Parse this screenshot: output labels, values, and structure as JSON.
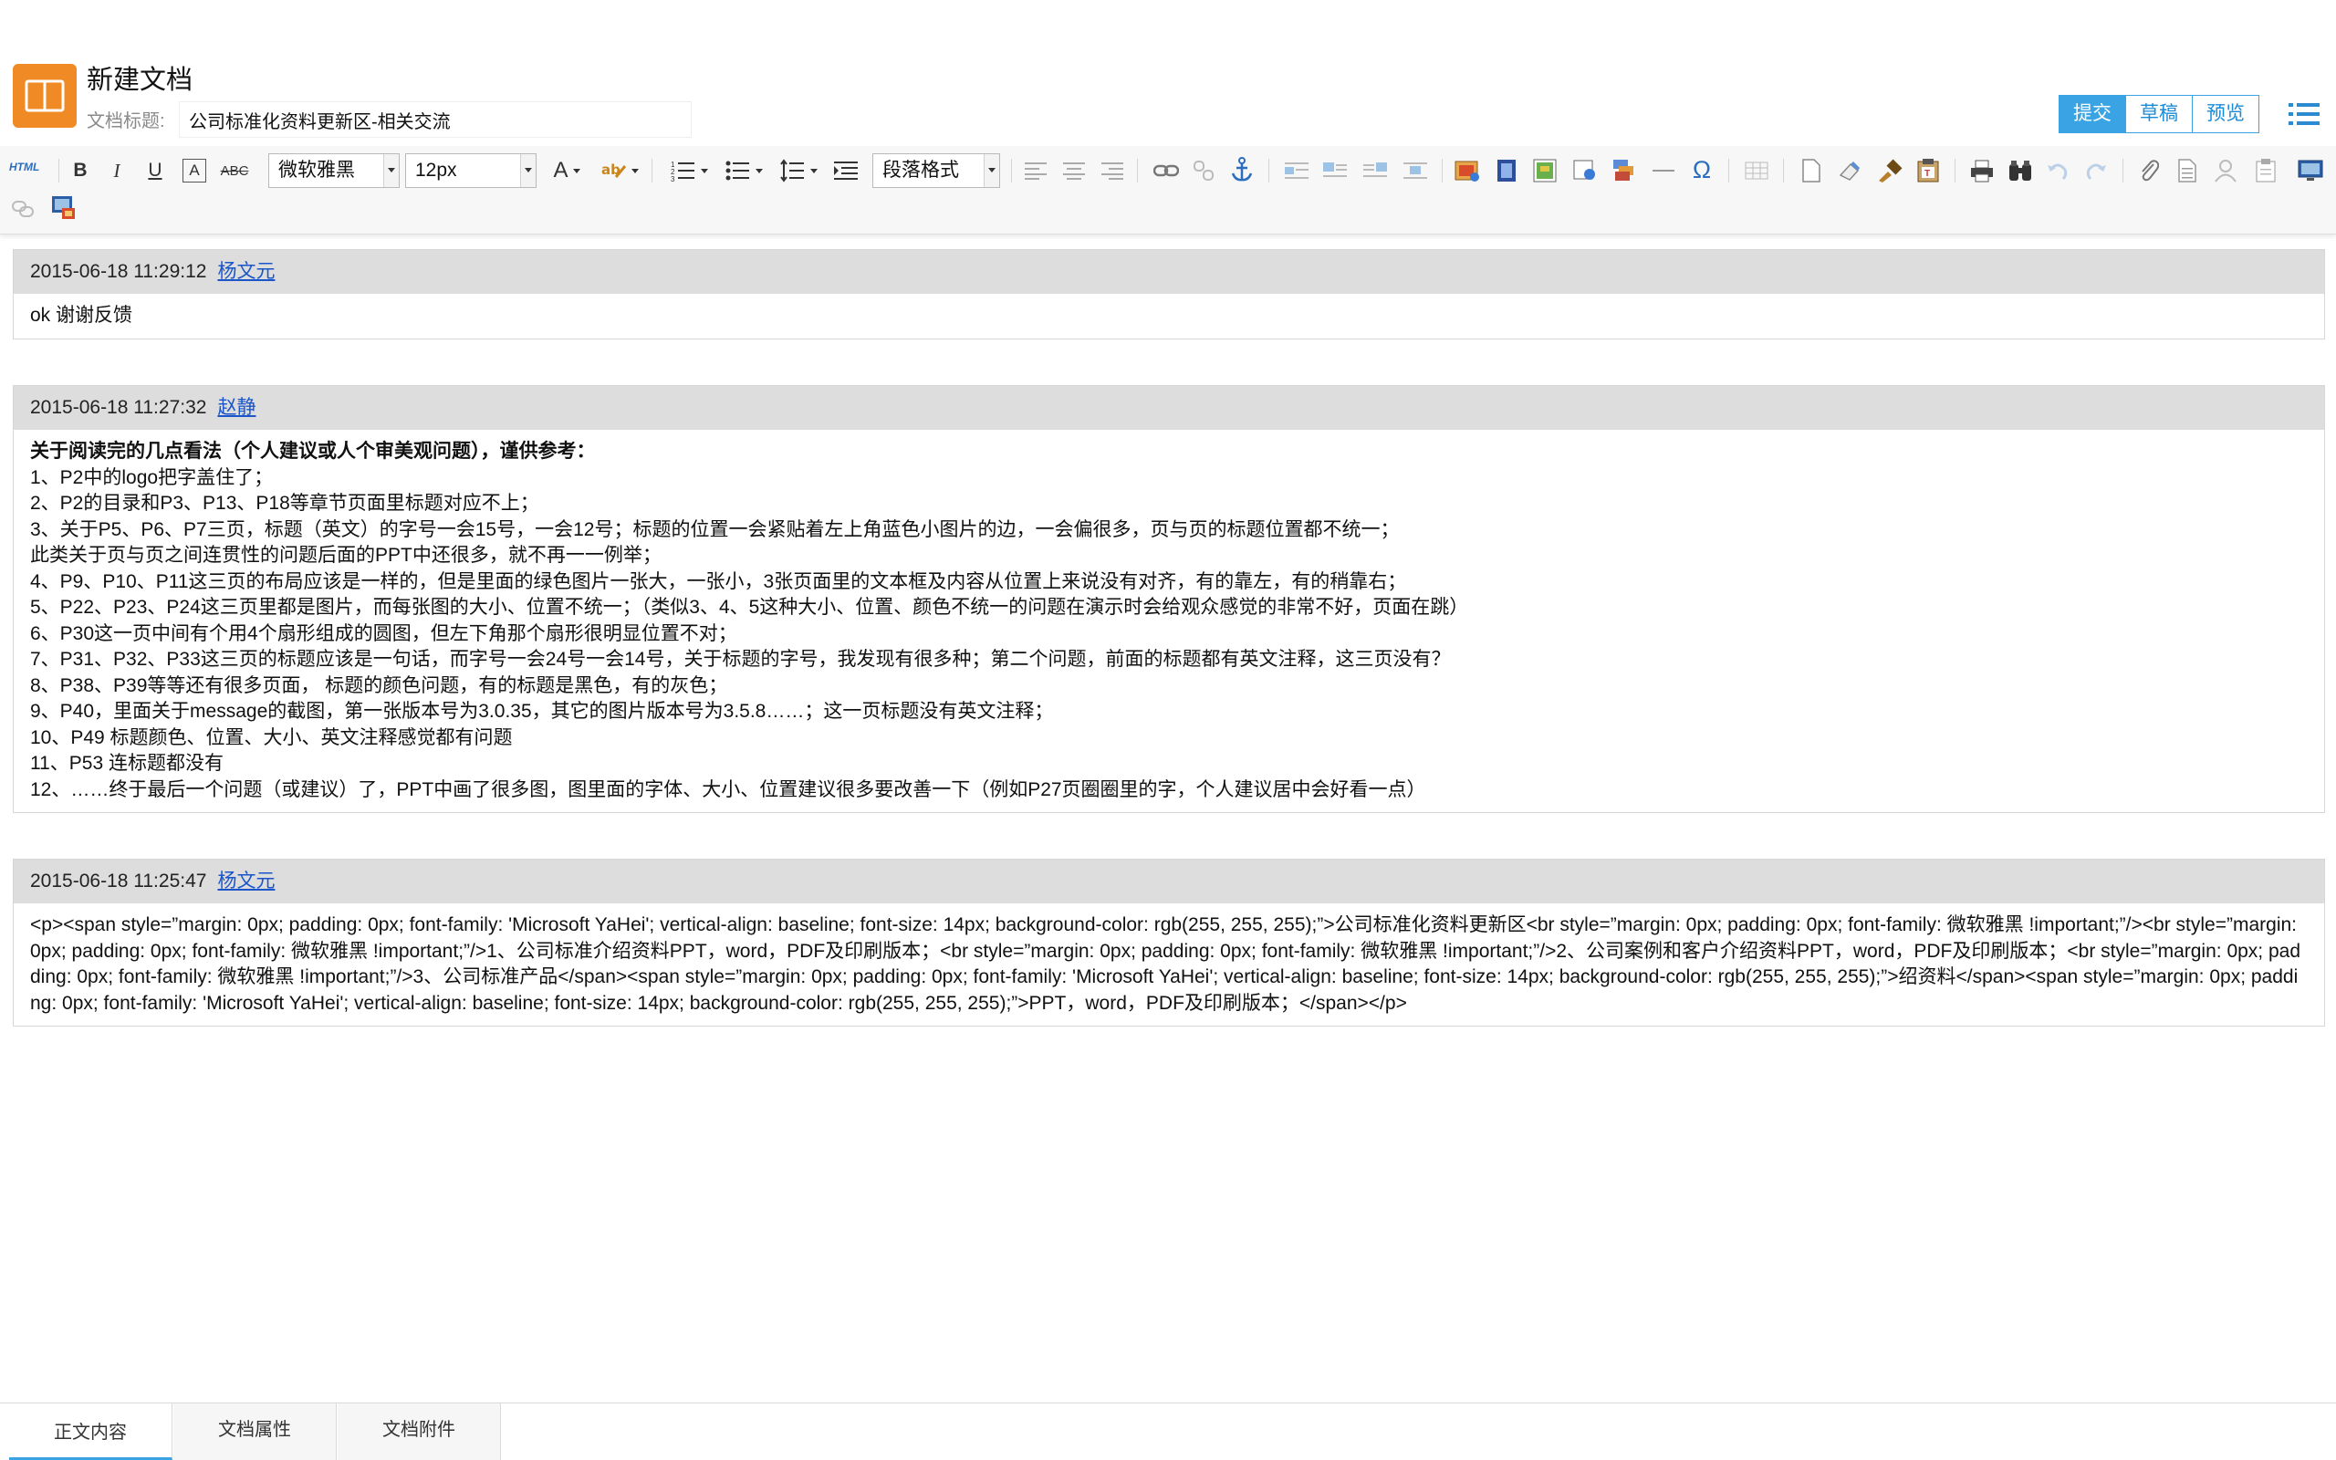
{
  "header": {
    "title": "新建文档",
    "title_label": "文档标题:",
    "title_value": "公司标准化资料更新区-相关交流",
    "actions": {
      "submit": "提交",
      "draft": "草稿",
      "preview": "预览"
    }
  },
  "toolbar": {
    "html_label": "HTML",
    "font_family": "微软雅黑",
    "font_size": "12px",
    "paragraph_format": "段落格式",
    "icons": [
      "html-source",
      "bold",
      "italic",
      "underline",
      "font-border",
      "strikethrough",
      "font-family",
      "font-size",
      "font-color",
      "back-color",
      "ordered-list",
      "unordered-list",
      "line-height",
      "indent",
      "paragraph",
      "justify-left",
      "justify-center",
      "justify-right",
      "link",
      "unlink",
      "anchor",
      "image-none",
      "image-left",
      "image-right",
      "image-center",
      "insert-image",
      "insert-video",
      "insert-map",
      "insert-frame",
      "insert-code",
      "horizontal-rule",
      "special-char",
      "insert-table",
      "new-doc",
      "eraser",
      "format-brush",
      "paste-plain",
      "print",
      "search-replace",
      "undo",
      "redo",
      "attachment",
      "template",
      "help",
      "clipboard",
      "fullscreen",
      "remove-format",
      "snapshot"
    ]
  },
  "comments": [
    {
      "time": "2015-06-18 11:29:12",
      "author": "杨文元",
      "lines": [
        "ok  谢谢反馈"
      ]
    },
    {
      "time": "2015-06-18 11:27:32",
      "author": "赵静",
      "heading": "关于阅读完的几点看法（个人建议或人个审美观问题），谨供参考：",
      "lines": [
        "1、P2中的logo把字盖住了；",
        "2、P2的目录和P3、P13、P18等章节页面里标题对应不上；",
        "3、关于P5、P6、P7三页，标题（英文）的字号一会15号，一会12号；标题的位置一会紧贴着左上角蓝色小图片的边，一会偏很多，页与页的标题位置都不统一；",
        "此类关于页与页之间连贯性的问题后面的PPT中还很多，就不再一一例举；",
        "4、P9、P10、P11这三页的布局应该是一样的，但是里面的绿色图片一张大，一张小，3张页面里的文本框及内容从位置上来说没有对齐，有的靠左，有的稍靠右；",
        "5、P22、P23、P24这三页里都是图片，而每张图的大小、位置不统一；（类似3、4、5这种大小、位置、颜色不统一的问题在演示时会给观众感觉的非常不好，页面在跳）",
        "6、P30这一页中间有个用4个扇形组成的圆图，但左下角那个扇形很明显位置不对；",
        "7、P31、P32、P33这三页的标题应该是一句话，而字号一会24号一会14号，关于标题的字号，我发现有很多种；第二个问题，前面的标题都有英文注释，这三页没有？",
        "8、P38、P39等等还有很多页面， 标题的颜色问题，有的标题是黑色，有的灰色；",
        "9、P40，里面关于message的截图，第一张版本号为3.0.35，其它的图片版本号为3.5.8……；这一页标题没有英文注释；",
        "10、P49 标题颜色、位置、大小、英文注释感觉都有问题",
        "11、P53 连标题都没有",
        "12、……终于最后一个问题（或建议）了，PPT中画了很多图，图里面的字体、大小、位置建议很多要改善一下（例如P27页圈圈里的字，个人建议居中会好看一点）"
      ]
    },
    {
      "time": "2015-06-18 11:25:47",
      "author": "杨文元",
      "code": "<p><span style=”margin: 0px; padding: 0px; font-family: 'Microsoft YaHei'; vertical-align: baseline; font-size: 14px; background-color: rgb(255, 255, 255);”>公司标准化资料更新区<br style=”margin: 0px; padding: 0px; font-family: 微软雅黑 !important;”/><br style=”margin: 0px; padding: 0px; font-family: 微软雅黑 !important;”/>1、公司标准介绍资料PPT，word，PDF及印刷版本；<br style=”margin: 0px; padding: 0px; font-family: 微软雅黑 !important;”/>2、公司案例和客户介绍资料PPT，word，PDF及印刷版本；<br style=”margin: 0px; padding: 0px; font-family: 微软雅黑 !important;”/>3、公司标准产品</span><span style=”margin: 0px; padding: 0px; font-family: 'Microsoft YaHei'; vertical-align: baseline; font-size: 14px; background-color: rgb(255, 255, 255);”>绍资料</span><span style=”margin: 0px; padding: 0px; font-family: 'Microsoft YaHei'; vertical-align: baseline; font-size: 14px; background-color: rgb(255, 255, 255);”>PPT，word，PDF及印刷版本；</span></p>"
    }
  ],
  "tabs": [
    "正文内容",
    "文档属性",
    "文档附件"
  ],
  "colors": {
    "accent": "#3aa3e3",
    "icon_orange": "#f08a24",
    "comment_header": "#dddddd",
    "author_link": "#1a55c9"
  }
}
